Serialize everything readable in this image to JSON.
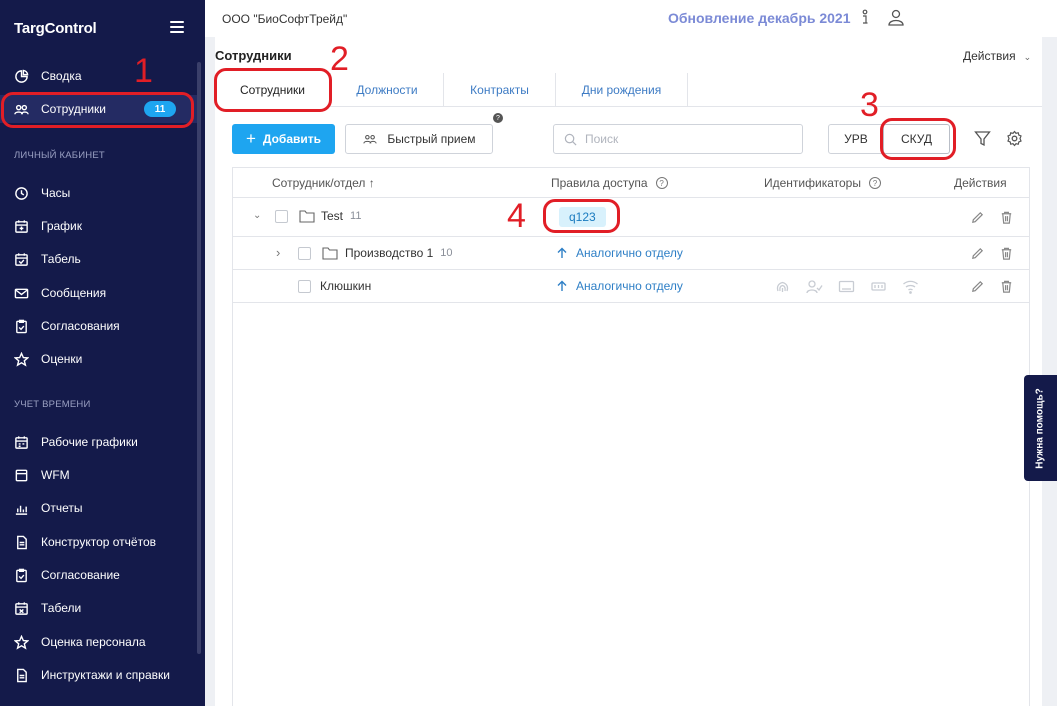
{
  "app": {
    "logo": "TargControl"
  },
  "sidebar": {
    "items_top": [
      {
        "label": "Сводка",
        "icon": "pie-chart-icon"
      },
      {
        "label": "Сотрудники",
        "icon": "users-icon",
        "badge": "11"
      }
    ],
    "section_personal": "ЛИЧНЫЙ КАБИНЕТ",
    "items_personal": [
      {
        "label": "Часы",
        "icon": "clock-icon"
      },
      {
        "label": "График",
        "icon": "calendar-icon"
      },
      {
        "label": "Табель",
        "icon": "calendar-check-icon"
      },
      {
        "label": "Сообщения",
        "icon": "mail-icon"
      },
      {
        "label": "Согласования",
        "icon": "clipboard-check-icon"
      },
      {
        "label": "Оценки",
        "icon": "star-icon"
      }
    ],
    "section_time": "УЧЕТ ВРЕМЕНИ",
    "items_time": [
      {
        "label": "Рабочие графики",
        "icon": "calendar-icon"
      },
      {
        "label": "WFM",
        "icon": "box-icon"
      },
      {
        "label": "Отчеты",
        "icon": "bar-chart-icon"
      },
      {
        "label": "Конструктор отчётов",
        "icon": "document-icon"
      },
      {
        "label": "Согласование",
        "icon": "clipboard-check-icon"
      },
      {
        "label": "Табели",
        "icon": "calendar-x-icon"
      },
      {
        "label": "Оценка персонала",
        "icon": "star-icon"
      },
      {
        "label": "Инструктажи и справки",
        "icon": "document-icon"
      }
    ]
  },
  "header": {
    "company": "ООО \"БиоСофтТрейд\"",
    "update": "Обновление декабрь 2021"
  },
  "page": {
    "title": "Сотрудники",
    "actions": "Действия",
    "tabs": [
      "Сотрудники",
      "Должности",
      "Контракты",
      "Дни рождения"
    ],
    "add_button": "Добавить",
    "quick_button": "Быстрый прием",
    "search_placeholder": "Поиск",
    "urv_button": "УРВ",
    "skud_button": "СКУД"
  },
  "table": {
    "headers": {
      "employee": "Сотрудник/отдел ↑",
      "access": "Правила доступа",
      "ids": "Идентификаторы",
      "actions": "Действия"
    },
    "rows": [
      {
        "name": "Test",
        "count": "11",
        "access_tag": "q123"
      },
      {
        "name": "Производство 1",
        "count": "10",
        "access": "Аналогично отделу"
      },
      {
        "name": "Клюшкин",
        "access": "Аналогично отделу"
      }
    ]
  },
  "help_tab": "Нужна помощь?",
  "annotations": [
    "1",
    "2",
    "3",
    "4"
  ],
  "colors": {
    "sidebar": "#141a4a",
    "accent": "#1ea5f0",
    "annotation": "#e11e26"
  }
}
